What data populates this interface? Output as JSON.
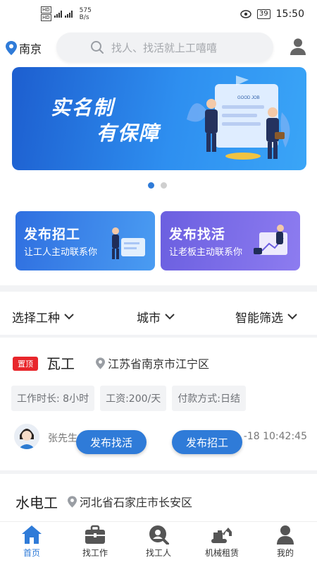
{
  "status_bar": {
    "network_speed_value": "575",
    "network_speed_unit": "B/s",
    "battery": "39",
    "time": "15:50"
  },
  "header": {
    "city": "南京",
    "search_placeholder": "找人、找活就上工嘻嘻"
  },
  "banner": {
    "line1": "实名制",
    "line2": "有保障",
    "board_text": "GOOD JOB",
    "page_count": 2,
    "active_index": 0
  },
  "quick_cards": [
    {
      "title": "发布招工",
      "subtitle": "让工人主动联系你"
    },
    {
      "title": "发布找活",
      "subtitle": "让老板主动联系你"
    }
  ],
  "filters": [
    "选择工种",
    "城市",
    "智能筛选"
  ],
  "jobs": [
    {
      "badge": "置顶",
      "title": "瓦工",
      "location": "江苏省南京市江宁区",
      "tags": [
        "工作时长: 8小时",
        "工资:200/天",
        "付款方式:日结"
      ],
      "poster_name": "张先生",
      "time_visible": "-18 10:42:45"
    },
    {
      "title": "水电工",
      "location": "河北省石家庄市长安区"
    }
  ],
  "floating_buttons": {
    "find_work": "发布找活",
    "recruit": "发布招工"
  },
  "tabbar": [
    {
      "label": "首页",
      "icon": "home-icon",
      "active": true
    },
    {
      "label": "找工作",
      "icon": "briefcase-icon",
      "active": false
    },
    {
      "label": "找工人",
      "icon": "find-worker-icon",
      "active": false
    },
    {
      "label": "机械租赁",
      "icon": "excavator-icon",
      "active": false
    },
    {
      "label": "我的",
      "icon": "person-icon",
      "active": false
    }
  ],
  "colors": {
    "accent": "#2f7bd8",
    "badge_red": "#e8262b",
    "card_blue": "#3d86ea",
    "card_purple": "#7a6ce8"
  }
}
